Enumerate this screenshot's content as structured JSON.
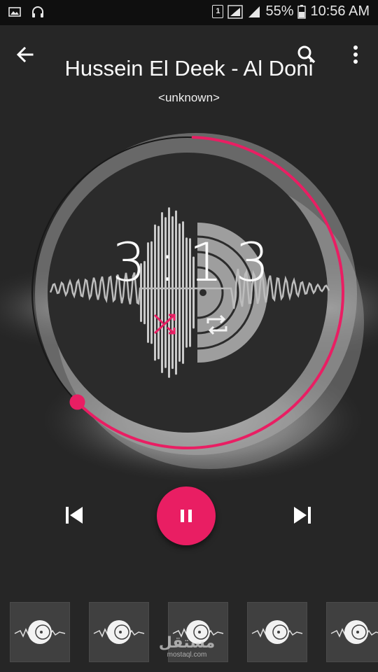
{
  "status_bar": {
    "sim_number": "1",
    "battery_percent": "55%",
    "time": "10:56 AM",
    "icons": [
      "gallery-icon",
      "headphones-icon",
      "sim-icon",
      "signal-icon",
      "battery-icon"
    ]
  },
  "toolbar": {
    "back_icon": "arrow-left-icon",
    "search_icon": "search-icon",
    "menu_icon": "more-vert-icon"
  },
  "track": {
    "title": "Hussein El Deek - Al Doni",
    "artist": "<unknown>",
    "time_display": "3:13",
    "progress": 0.62
  },
  "controls": {
    "shuffle_icon": "shuffle-icon",
    "repeat_icon": "repeat-icon",
    "previous_icon": "skip-previous-icon",
    "play_pause_icon": "pause-icon",
    "next_icon": "skip-next-icon"
  },
  "colors": {
    "accent": "#e91e63",
    "background": "#262626",
    "status_bar": "#0f0f0f"
  },
  "queue": {
    "items": [
      {
        "icon": "vinyl-wave-icon"
      },
      {
        "icon": "vinyl-wave-icon"
      },
      {
        "icon": "vinyl-wave-icon"
      },
      {
        "icon": "vinyl-wave-icon"
      },
      {
        "icon": "vinyl-wave-icon"
      }
    ]
  },
  "watermark": {
    "arabic": "مستقل",
    "latin": "mostaql.com"
  }
}
